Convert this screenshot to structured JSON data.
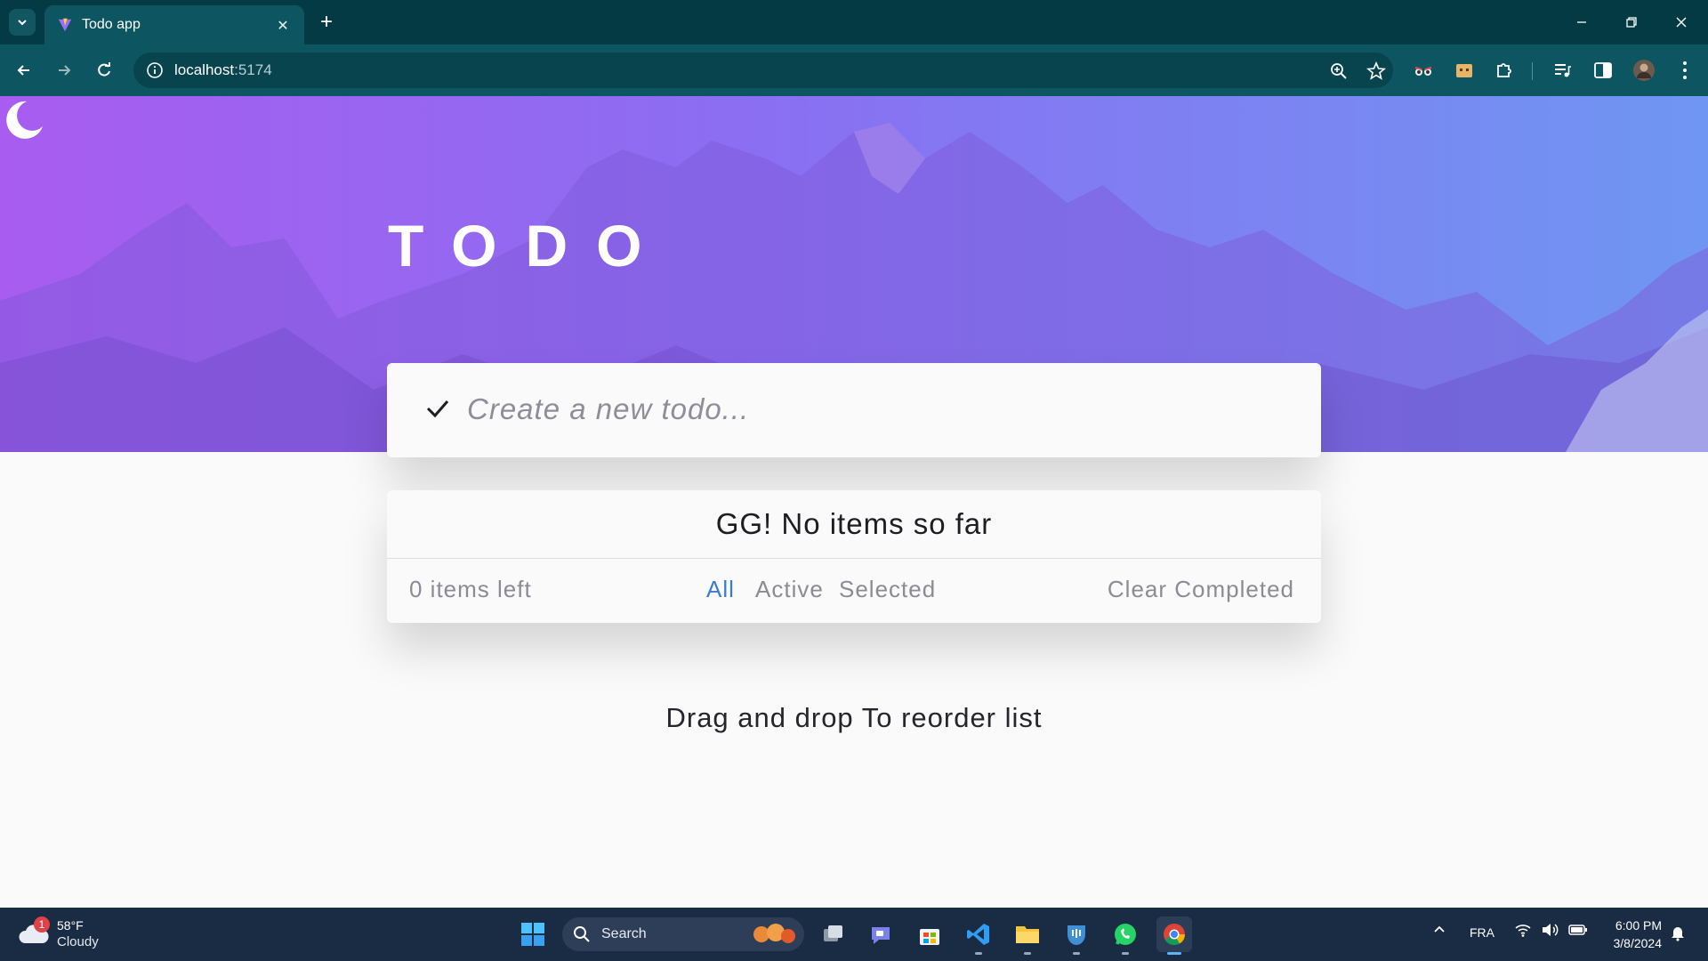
{
  "browser": {
    "tab_title": "Todo app",
    "url_host": "localhost",
    "url_port": ":5174"
  },
  "app": {
    "title": "TODO",
    "new_todo_placeholder": "Create a new todo...",
    "empty_message": "GG! No items so far",
    "items_left": "0 items left",
    "filters": [
      "All",
      "Active",
      "Selected"
    ],
    "active_filter": "All",
    "clear_label": "Clear Completed",
    "hint": "Drag and drop To reorder list",
    "accent_color": "#3a7bd5"
  },
  "taskbar": {
    "weather_badge": "1",
    "weather_temp": "58°F",
    "weather_cond": "Cloudy",
    "search_label": "Search",
    "language": "FRA",
    "time": "6:00 PM",
    "date": "3/8/2024"
  }
}
